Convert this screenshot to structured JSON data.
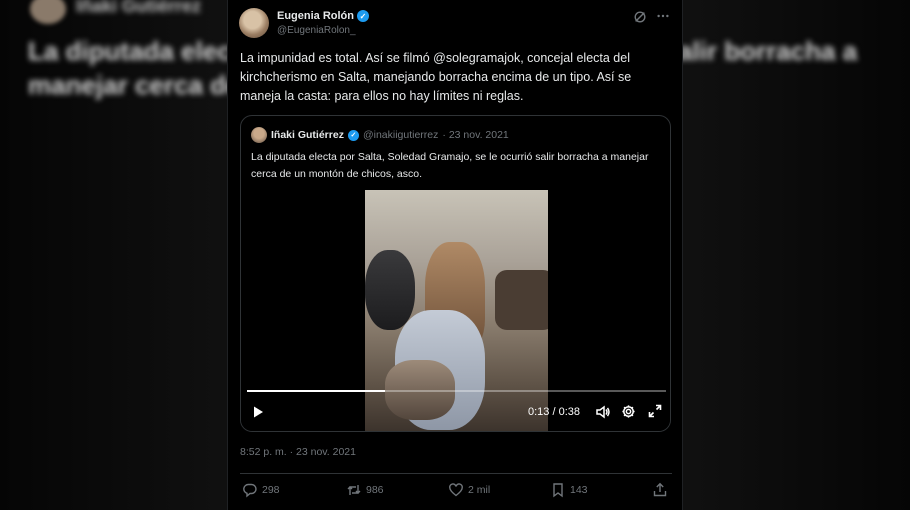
{
  "backdrop": {
    "name": "Iñaki Gutiérrez",
    "line1": "La diputada electa",
    "line2": "manejar cerca de u",
    "line3": "alir borracha a"
  },
  "tweet": {
    "author_name": "Eugenia Rolón",
    "author_handle": "@EugeniaRolon_",
    "text": "La impunidad es total. Así se filmó @solegramajok, concejal electa del kirchcherismo en Salta, manejando borracha encima de un tipo. Así se maneja la casta: para ellos no hay límites ni reglas.",
    "timestamp": "8:52 p. m. · 23 nov. 2021",
    "icons": {
      "grok": "grok-icon",
      "more": "more-icon",
      "verified": "verified-icon"
    }
  },
  "quote": {
    "author_name": "Iñaki Gutiérrez",
    "author_handle": "@inakiigutierrez",
    "date": "· 23 nov. 2021",
    "text": "La diputada electa por Salta, Soledad Gramajo, se le ocurrió salir borracha a manejar cerca de un montón de chicos, asco.",
    "video": {
      "current_time": "0:13",
      "separator": "/",
      "duration": "0:38",
      "progress": 0.33
    }
  },
  "actions": {
    "replies": "298",
    "retweets": "986",
    "likes": "2 mil",
    "bookmarks": "143"
  },
  "colors": {
    "accent": "#1d9bf0",
    "text_primary": "#e7e9ea",
    "text_secondary": "#71767b",
    "border": "#2f3336",
    "background": "#000000"
  }
}
